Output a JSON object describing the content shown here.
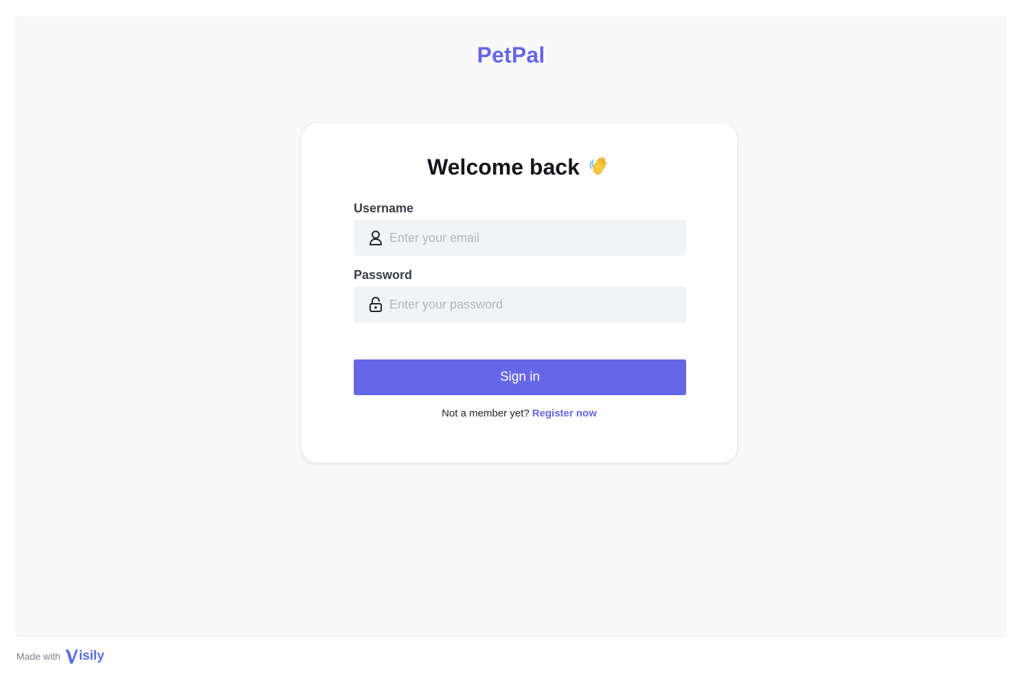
{
  "brand": {
    "name": "PetPal",
    "color": "#6466e8"
  },
  "login": {
    "title": "Welcome back",
    "title_emoji": "waving-hand-icon",
    "username": {
      "label": "Username",
      "placeholder": "Enter your email",
      "value": "",
      "icon": "user-icon"
    },
    "password": {
      "label": "Password",
      "placeholder": "Enter your password",
      "value": "",
      "icon": "lock-icon"
    },
    "submit_label": "Sign in",
    "register_prompt": "Not a member yet?",
    "register_link": "Register now"
  },
  "footer": {
    "made_with": "Made with",
    "logo_text": "isily"
  }
}
